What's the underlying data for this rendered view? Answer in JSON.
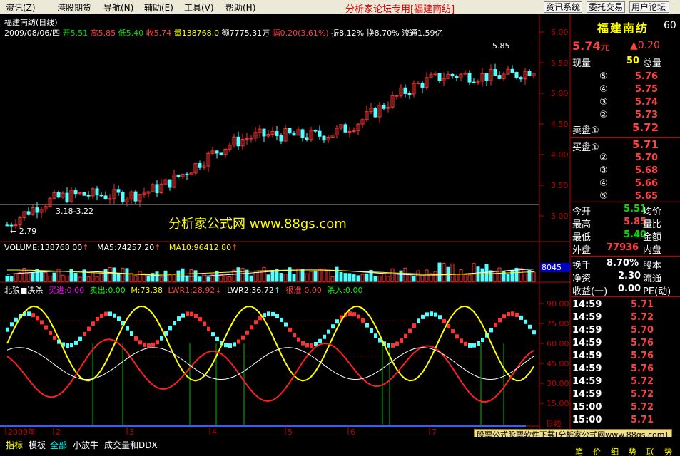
{
  "menu": {
    "items": [
      "资讯(Z)",
      "港股期货",
      "导航(N)",
      "辅助(E)",
      "工具(V)",
      "帮助(H)"
    ]
  },
  "header": {
    "center_title": "分析家论坛专用",
    "center_stock": "[福建南纺]",
    "btn_info": "资讯系统",
    "btn_trade": "委托交易",
    "btn_forum": "用户论坛"
  },
  "stock": {
    "name": "福建南纺",
    "code_fragment": "60",
    "period_label": "福建南纺(日线)"
  },
  "ohlc": {
    "date": "2009/08/06/四",
    "open_label": "开",
    "open": "5.51",
    "high_label": "高",
    "high": "5.85",
    "low_label": "低",
    "low": "5.40",
    "close_label": "收",
    "close": "5.74",
    "vol_label": "量",
    "vol": "138768.0",
    "amount_label": "额",
    "amount": "7775.31万",
    "chg_label": "幅",
    "chg": "0.20(3.61%)",
    "amp_label": "振",
    "amp": "8.12%",
    "turn_label": "换",
    "turn": "8.70%",
    "float_label": "流通",
    "float": "1.59亿"
  },
  "annot": {
    "peak": "5.85",
    "low": "2.79",
    "range": "3.18-3.22",
    "watermark": "分析家公式网 www.88gs.com"
  },
  "price_axis": [
    "6.00",
    "5.50",
    "5.00",
    "4.50",
    "4.00",
    "3.50",
    "3.00"
  ],
  "vol_panel": {
    "label": "VOLUME:138768.00",
    "ma5": "MA5:74257.20",
    "ma10": "MA10:96412.80",
    "axis_val": "8045"
  },
  "indicator": {
    "name": "北狼■决杀",
    "buy": "买进:0.00",
    "sell": "卖出:0.00",
    "m": "M:73.38",
    "lwr1": "LWR1:28.92",
    "lwr2": "LWR2:36.72",
    "risk": "很准:0.00",
    "kill": "杀入:0.00",
    "axis": [
      "90.00",
      "75.00",
      "60.00",
      "45.00",
      "30.00",
      "15.00"
    ],
    "axis_tail": "日线"
  },
  "date_axis": [
    "2009年",
    "2",
    "3",
    "4",
    "5",
    "6",
    "7"
  ],
  "quote": {
    "price": "5.74",
    "unit": "元",
    "chg": "▲0.20",
    "xianliang": "现量",
    "xianliang_val": "50",
    "zongliang": "总量",
    "asks": [
      {
        "n": "⑤",
        "p": "5.76"
      },
      {
        "n": "④",
        "p": "5.75"
      },
      {
        "n": "③",
        "p": "5.74"
      },
      {
        "n": "②",
        "p": "5.73"
      },
      {
        "n": "卖盘①",
        "p": "5.72"
      }
    ],
    "bids": [
      {
        "n": "买盘①",
        "p": "5.71"
      },
      {
        "n": "②",
        "p": "5.70"
      },
      {
        "n": "③",
        "p": "5.68"
      },
      {
        "n": "④",
        "p": "5.66"
      },
      {
        "n": "⑤",
        "p": "5.65"
      }
    ],
    "stats": [
      {
        "k": "今开",
        "v": "5.51",
        "k2": "均价"
      },
      {
        "k": "最高",
        "v": "5.85",
        "k2": "量比"
      },
      {
        "k": "最低",
        "v": "5.40",
        "k2": "金额"
      },
      {
        "k": "外盘",
        "v": "77936",
        "k2": "内盘"
      }
    ],
    "stats2": [
      {
        "k": "换手",
        "v": "8.70%",
        "k2": "股本"
      },
      {
        "k": "净资",
        "v": "2.30",
        "k2": "流通"
      },
      {
        "k": "收益(一)",
        "v": "0.00",
        "k2": "PE(动)"
      }
    ],
    "ticks": [
      {
        "t": "14:59",
        "p": "5.71"
      },
      {
        "t": "14:59",
        "p": "5.72"
      },
      {
        "t": "14:59",
        "p": "5.70"
      },
      {
        "t": "14:59",
        "p": "5.76"
      },
      {
        "t": "14:59",
        "p": "5.76"
      },
      {
        "t": "14:59",
        "p": "5.76"
      },
      {
        "t": "14:59",
        "p": "5.72"
      },
      {
        "t": "14:59",
        "p": "5.72"
      },
      {
        "t": "15:00",
        "p": "5.72"
      },
      {
        "t": "15:00",
        "p": "5.71"
      }
    ],
    "tabs": [
      "笔",
      "价",
      "细",
      "势",
      "联",
      "势"
    ]
  },
  "bottom": {
    "tabs": [
      "指标",
      "模板",
      "全部",
      "小放牛",
      "成交量和DDX"
    ],
    "ad": "股票公式股票软件下载[分析家公式网www.88gs.com]"
  },
  "colors": {
    "up": "#ff3232",
    "down": "#54ffff",
    "axis": "#c00000",
    "yellow": "#ffff00",
    "green": "#00c000",
    "magenta": "#ff00ff"
  }
}
